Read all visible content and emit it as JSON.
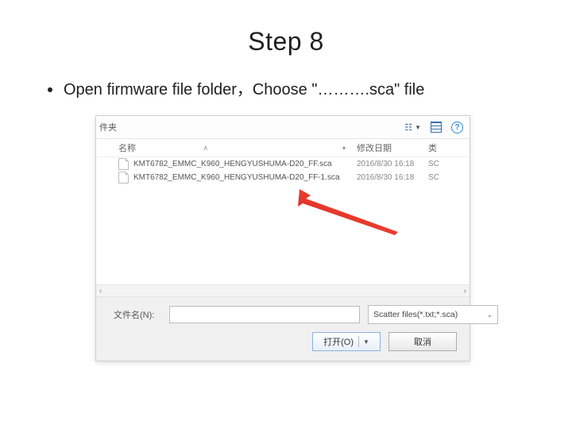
{
  "slide": {
    "title": "Step 8",
    "bullet": "Open firmware file folder，Choose \"……….sca\" file"
  },
  "dialog": {
    "top_left_fragment": "件夹",
    "view_menu_label": "☷",
    "help_glyph": "?",
    "columns": {
      "name": "名称",
      "date": "修改日期",
      "type": "类"
    },
    "rows": [
      {
        "name": "KMT6782_EMMC_K960_HENGYUSHUMA-D20_FF.sca",
        "date": "2016/8/30 16:18",
        "type": "SC"
      },
      {
        "name": "KMT6782_EMMC_K960_HENGYUSHUMA-D20_FF-1.sca",
        "date": "2016/8/30 16:18",
        "type": "SC"
      }
    ],
    "footer": {
      "filename_label": "文件名(N):",
      "filename_value": "",
      "filter_label": "Scatter files(*.txt;*.sca)",
      "open_label": "打开(O)",
      "cancel_label": "取消"
    },
    "nav_left_glyph": "‹",
    "nav_right_glyph": "›"
  }
}
